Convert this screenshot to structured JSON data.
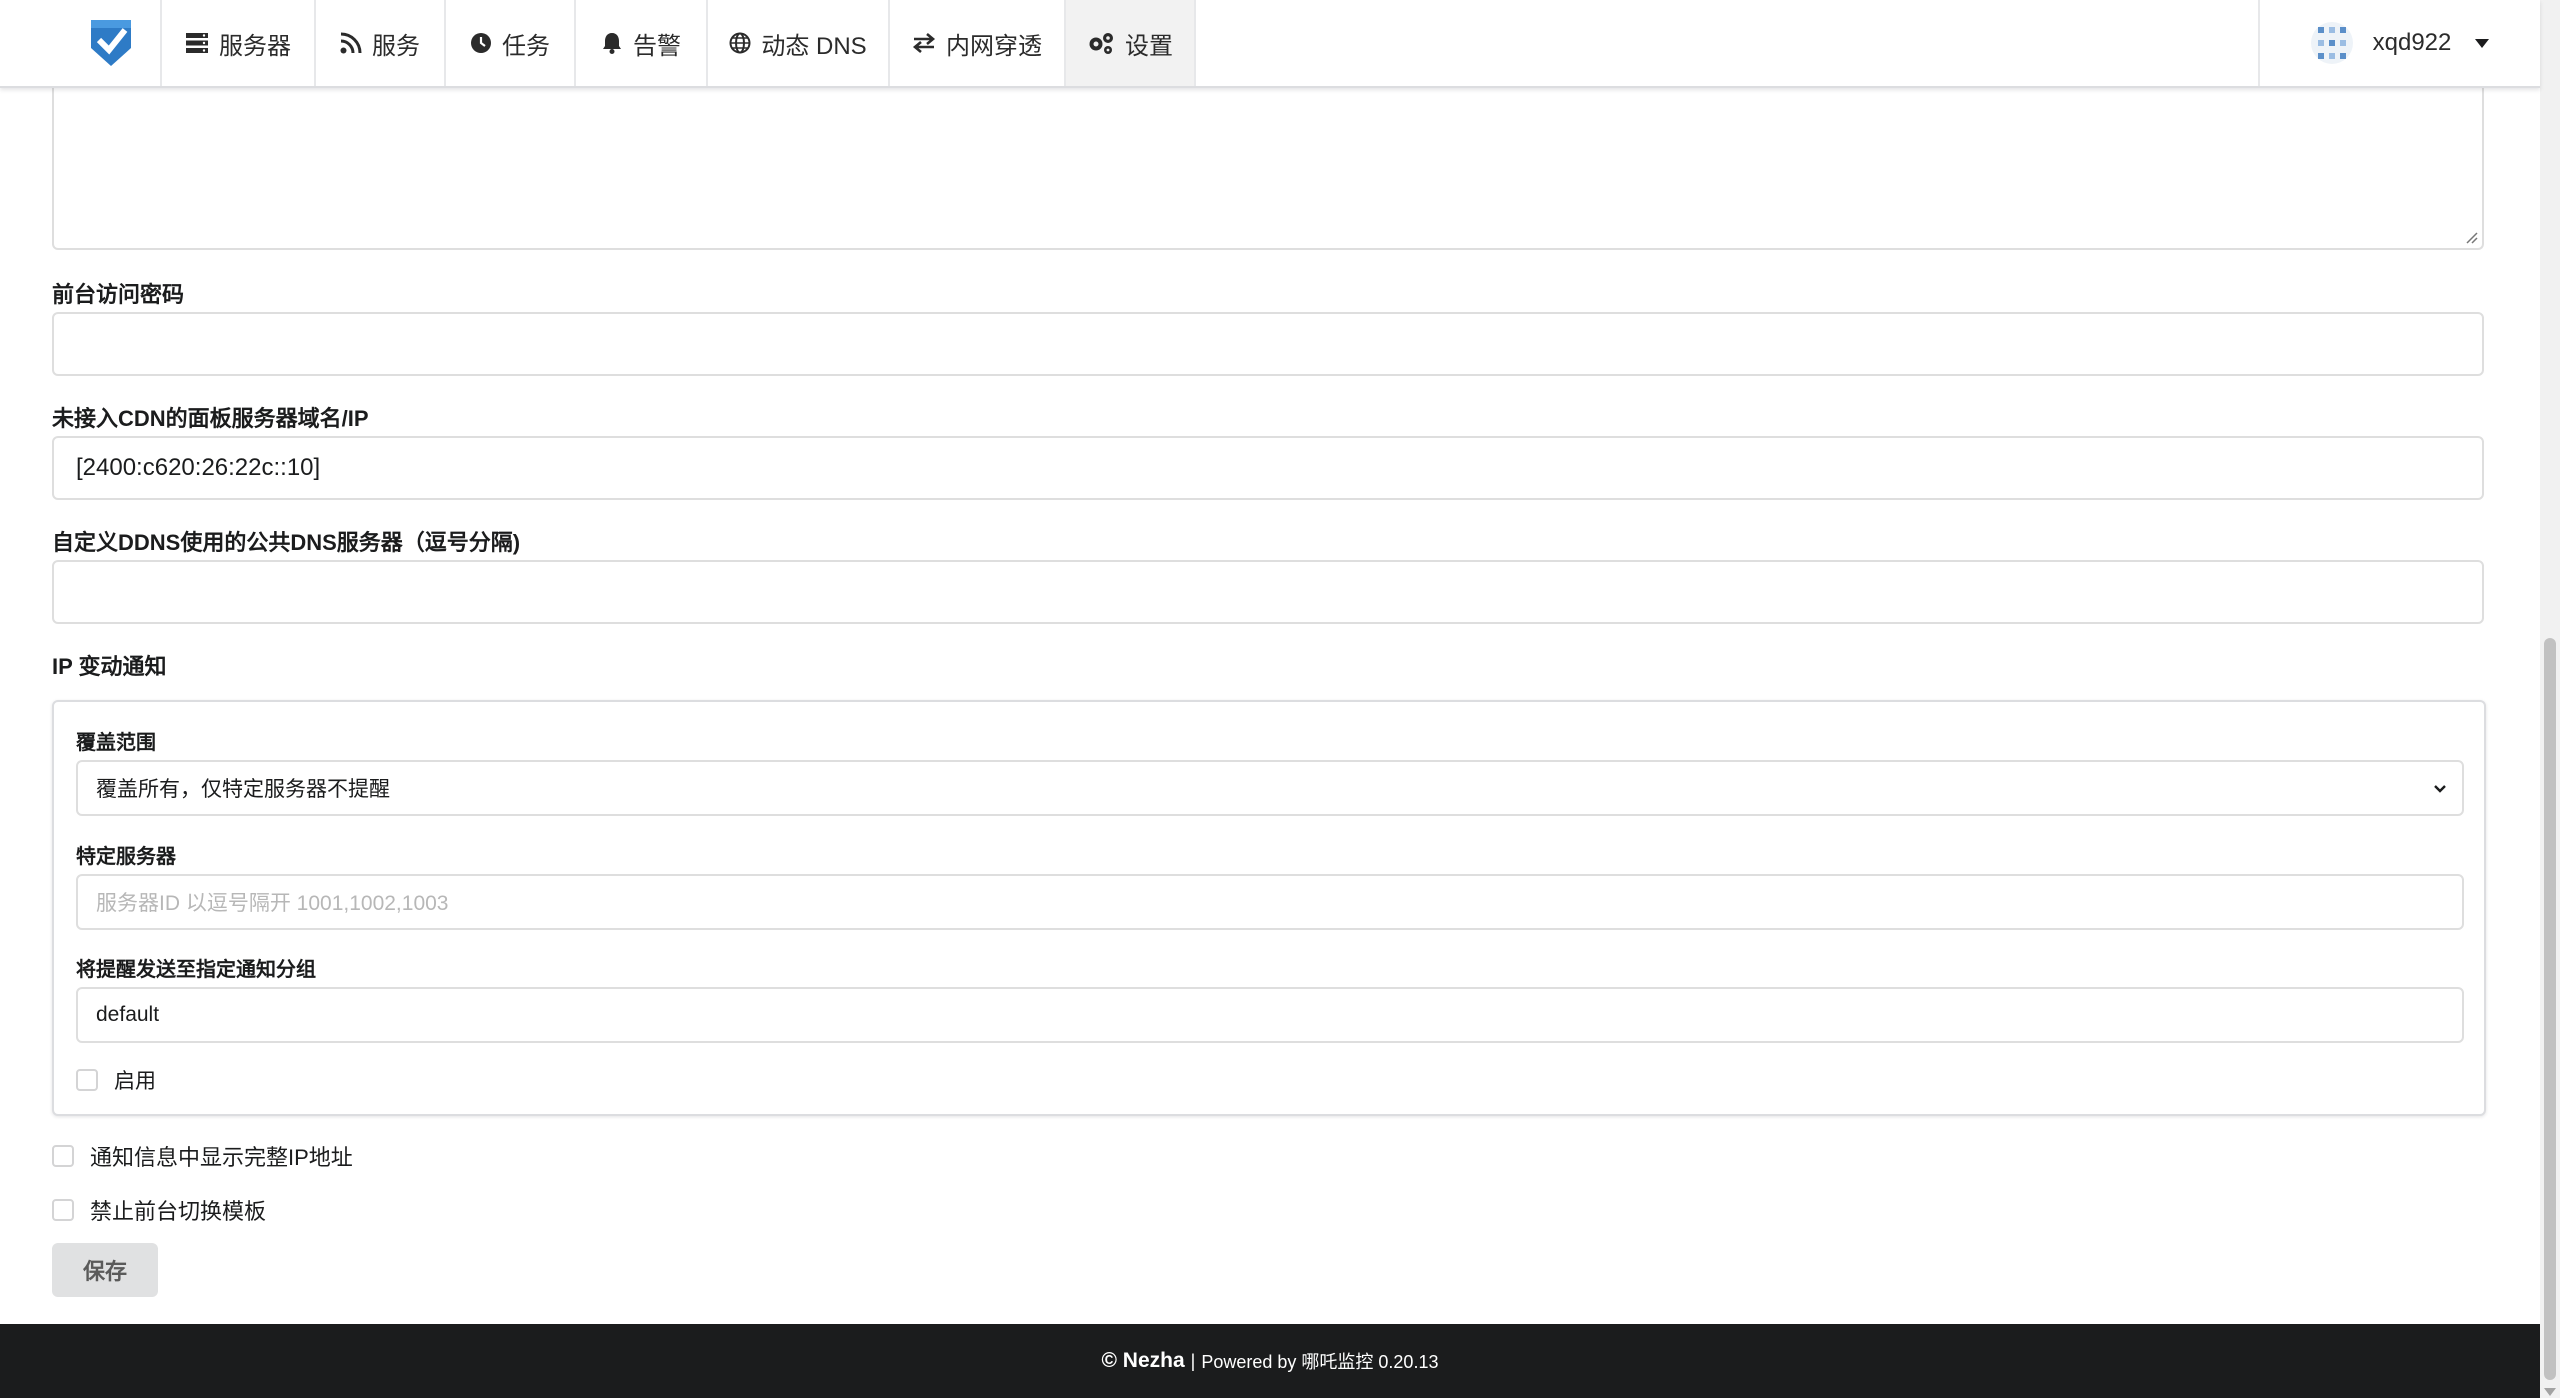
{
  "nav": {
    "items": [
      {
        "label": "服务器",
        "icon": "server-icon"
      },
      {
        "label": "服务",
        "icon": "rss-icon"
      },
      {
        "label": "任务",
        "icon": "clock-icon"
      },
      {
        "label": "告警",
        "icon": "bell-icon"
      },
      {
        "label": "动态 DNS",
        "icon": "globe-icon"
      },
      {
        "label": "内网穿透",
        "icon": "exchange-icon"
      },
      {
        "label": "设置",
        "icon": "gears-icon"
      }
    ],
    "user": {
      "name": "xqd922"
    }
  },
  "form": {
    "frontend_password": {
      "label": "前台访问密码",
      "value": ""
    },
    "panel_domain": {
      "label": "未接入CDN的面板服务器域名/IP",
      "value": "[2400:c620:26:22c::10]"
    },
    "ddns_dns": {
      "label": "自定义DDNS使用的公共DNS服务器（逗号分隔)",
      "value": ""
    },
    "ip_change": {
      "title": "IP 变动通知",
      "scope_label": "覆盖范围",
      "scope_value": "覆盖所有，仅特定服务器不提醒",
      "servers_label": "特定服务器",
      "servers_placeholder": "服务器ID 以逗号隔开 1001,1002,1003",
      "group_label": "将提醒发送至指定通知分组",
      "group_value": "default",
      "enable_label": "启用"
    },
    "show_full_ip_label": "通知信息中显示完整IP地址",
    "disable_theme_switch_label": "禁止前台切换模板",
    "save_label": "保存"
  },
  "footer": {
    "brand": "© Nezha",
    "separator": "|",
    "powered": "Powered by 哪吒监控 0.20.13"
  },
  "colors": {
    "brand_blue": "#3b82c4",
    "footer_bg": "#1b1c1d",
    "active_tab_bg": "#f2f2f2"
  }
}
